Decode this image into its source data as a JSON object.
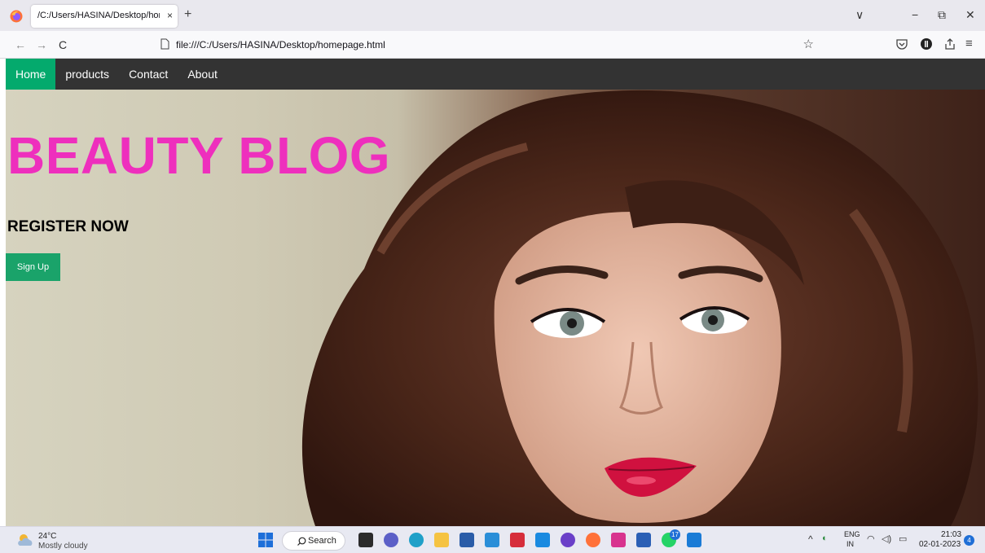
{
  "browser": {
    "tab_title": "/C:/Users/HASINA/Desktop/homep",
    "tab_close": "×",
    "new_tab": "+",
    "url": "file:///C:/Users/HASINA/Desktop/homepage.html",
    "back": "←",
    "forward": "→",
    "reload": "C",
    "bookmark_star": "☆",
    "tab_list": "∨",
    "minimize": "−",
    "restore": "⧉",
    "close": "✕",
    "menu": "≡"
  },
  "site": {
    "nav": [
      "Home",
      "products",
      "Contact",
      "About"
    ],
    "title": "BEAUTY BLOG",
    "register": "REGISTER NOW",
    "signup_label": "Sign Up"
  },
  "taskbar": {
    "temp": "24°C",
    "weather": "Mostly cloudy",
    "search_label": "Search",
    "lang_top": "ENG",
    "lang_bottom": "IN",
    "time": "21:03",
    "date": "02-01-2023",
    "notifications": "4",
    "badge": "17"
  },
  "colors": {
    "nav_bg": "#333333",
    "nav_active": "#04aa6d",
    "title": "#ee2fbd",
    "signup": "#1aa36a"
  }
}
